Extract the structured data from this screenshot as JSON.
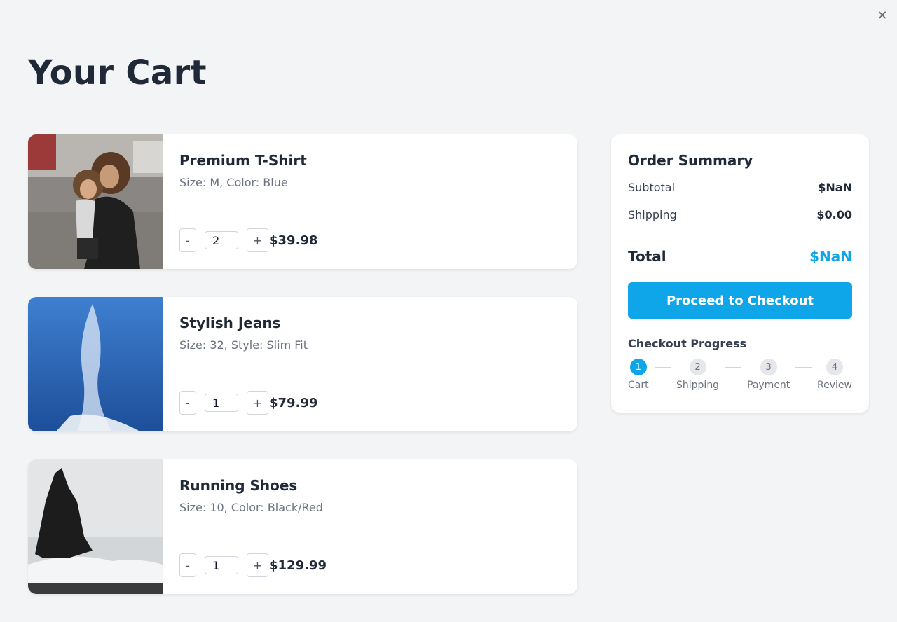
{
  "page": {
    "title": "Your Cart",
    "close_glyph": "✕"
  },
  "items": [
    {
      "name": "Premium T-Shirt",
      "variant": "Size: M, Color: Blue",
      "quantity": "2",
      "price": "$39.98",
      "decrement": "-",
      "increment": "+",
      "image": "mother-and-child-street-photo"
    },
    {
      "name": "Stylish Jeans",
      "variant": "Size: 32, Style: Slim Fit",
      "quantity": "1",
      "price": "$79.99",
      "decrement": "-",
      "increment": "+",
      "image": "blue-sky-waterfall-spray-photo"
    },
    {
      "name": "Running Shoes",
      "variant": "Size: 10, Color: Black/Red",
      "quantity": "1",
      "price": "$129.99",
      "decrement": "-",
      "increment": "+",
      "image": "sea-stack-rock-coast-photo"
    }
  ],
  "summary": {
    "title": "Order Summary",
    "subtotal_label": "Subtotal",
    "subtotal_value": "$NaN",
    "shipping_label": "Shipping",
    "shipping_value": "$0.00",
    "total_label": "Total",
    "total_value": "$NaN",
    "checkout_label": "Proceed to Checkout",
    "progress_title": "Checkout Progress",
    "steps": [
      {
        "number": "1",
        "label": "Cart",
        "active": true
      },
      {
        "number": "2",
        "label": "Shipping",
        "active": false
      },
      {
        "number": "3",
        "label": "Payment",
        "active": false
      },
      {
        "number": "4",
        "label": "Review",
        "active": false
      }
    ]
  },
  "colors": {
    "accent": "#0ea5e9",
    "background": "#f3f4f6",
    "text": "#1f2937",
    "muted": "#6b7280"
  }
}
